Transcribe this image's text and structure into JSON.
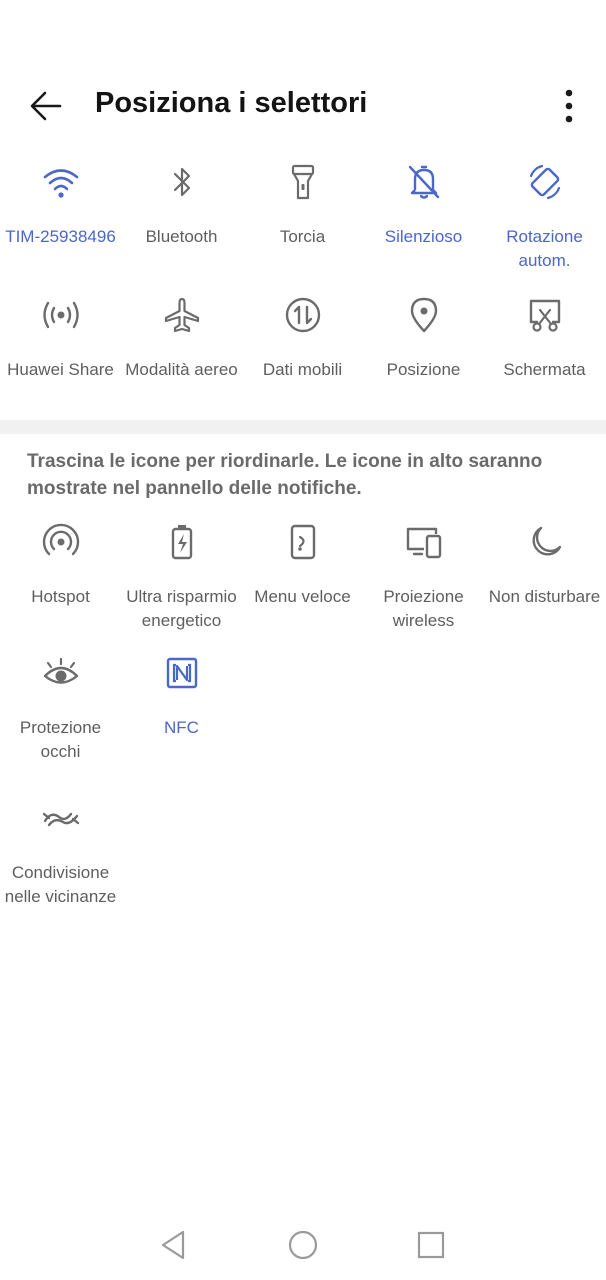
{
  "header": {
    "title": "Posiziona i selettori",
    "back_icon": "arrow-left-icon",
    "more_icon": "more-vert-icon"
  },
  "colors": {
    "accent": "#4a67c9",
    "icon_gray": "#6b6b6b",
    "divider": "#f1f1f1"
  },
  "active_tiles": {
    "row1": [
      {
        "label": "TIM-25938496",
        "icon": "wifi-icon",
        "active": true
      },
      {
        "label": "Bluetooth",
        "icon": "bluetooth-icon",
        "active": false
      },
      {
        "label": "Torcia",
        "icon": "flashlight-icon",
        "active": false
      },
      {
        "label": "Silenzioso",
        "icon": "bell-off-icon",
        "active": true
      },
      {
        "label": "Rotazione autom.",
        "icon": "rotate-icon",
        "active": true
      }
    ],
    "row2": [
      {
        "label": "Huawei Share",
        "icon": "huawei-share-icon",
        "active": false
      },
      {
        "label": "Modalità aereo",
        "icon": "airplane-icon",
        "active": false
      },
      {
        "label": "Dati mobili",
        "icon": "mobile-data-icon",
        "active": false
      },
      {
        "label": "Posizione",
        "icon": "location-pin-icon",
        "active": false
      },
      {
        "label": "Schermata",
        "icon": "screenshot-icon",
        "active": false
      }
    ]
  },
  "hint": "Trascina le icone per riordinarle. Le icone in alto saranno mostrate nel pannello delle notifiche.",
  "available_tiles": {
    "row1": [
      {
        "label": "Hotspot",
        "icon": "hotspot-icon",
        "active": false
      },
      {
        "label": "Ultra risparmio energetico",
        "icon": "battery-saver-icon",
        "active": false
      },
      {
        "label": "Menu veloce",
        "icon": "quick-menu-icon",
        "active": false
      },
      {
        "label": "Proiezione wireless",
        "icon": "wireless-projection-icon",
        "active": false
      },
      {
        "label": "Non disturbare",
        "icon": "moon-icon",
        "active": false
      }
    ],
    "row2": [
      {
        "label": "Protezione occhi",
        "icon": "eye-icon",
        "active": false
      },
      {
        "label": "NFC",
        "icon": "nfc-icon",
        "active": true
      }
    ],
    "row3": [
      {
        "label": "Condivisione nelle vicinanze",
        "icon": "nearby-share-icon",
        "active": false
      }
    ]
  },
  "navbar": {
    "back_icon": "nav-back-icon",
    "home_icon": "nav-home-icon",
    "recents_icon": "nav-recents-icon"
  }
}
